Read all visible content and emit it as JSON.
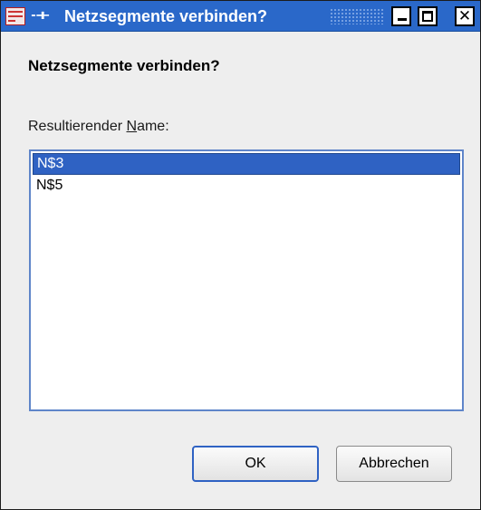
{
  "window": {
    "title": "Netzsegmente verbinden?",
    "pin_icon_text": "-⊣⊢"
  },
  "dialog": {
    "heading": "Netzsegmente verbinden?",
    "label_prefix": "Resultierender ",
    "label_mnemonic": "N",
    "label_suffix": "ame:"
  },
  "list": {
    "items": [
      {
        "label": "N$3",
        "selected": true
      },
      {
        "label": "N$5",
        "selected": false
      }
    ]
  },
  "buttons": {
    "ok_label": "OK",
    "cancel_label": "Abbrechen"
  },
  "colors": {
    "titlebar": "#2a68c9",
    "selection": "#2f62c3",
    "list_border": "#5f85c9",
    "dialog_bg": "#eeeeee"
  },
  "icons": {
    "app": "app-icon",
    "pin": "pin-icon",
    "minimize": "minimize-icon",
    "maximize": "maximize-icon",
    "close": "close-icon"
  }
}
